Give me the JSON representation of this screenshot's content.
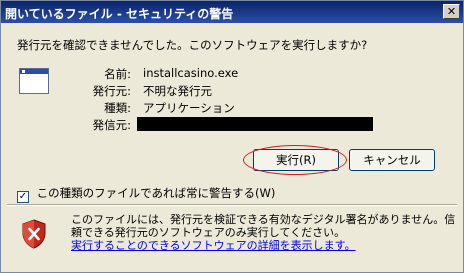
{
  "window": {
    "title": "開いているファイル - セキュリティの警告",
    "close_glyph": "✕"
  },
  "question": "発行元を確認できませんでした。このソフトウェアを実行しますか?",
  "fields": [
    {
      "label": "名前:",
      "value": "installcasino.exe"
    },
    {
      "label": "発行元:",
      "value": "不明な発行元"
    },
    {
      "label": "種類:",
      "value": "アプリケーション"
    },
    {
      "label": "発信元:",
      "value": ""
    }
  ],
  "buttons": {
    "run": "実行(R)",
    "cancel": "キャンセル"
  },
  "checkbox": {
    "label": "この種類のファイルであれば常に警告する(W)",
    "checked": true,
    "check_glyph": "✓"
  },
  "warning": {
    "text": "このファイルには、発行元を検証できる有効なデジタル署名がありません。信頼できる発行元のソフトウェアのみ実行してください。",
    "link": "実行することのできるソフトウェアの詳細を表示します。"
  },
  "colors": {
    "titlebar": "#0a246a",
    "highlight_ellipse": "#d81c1c",
    "link": "#0000ee"
  },
  "icons": {
    "app": "application-window-icon",
    "shield": "security-shield-x-icon"
  }
}
